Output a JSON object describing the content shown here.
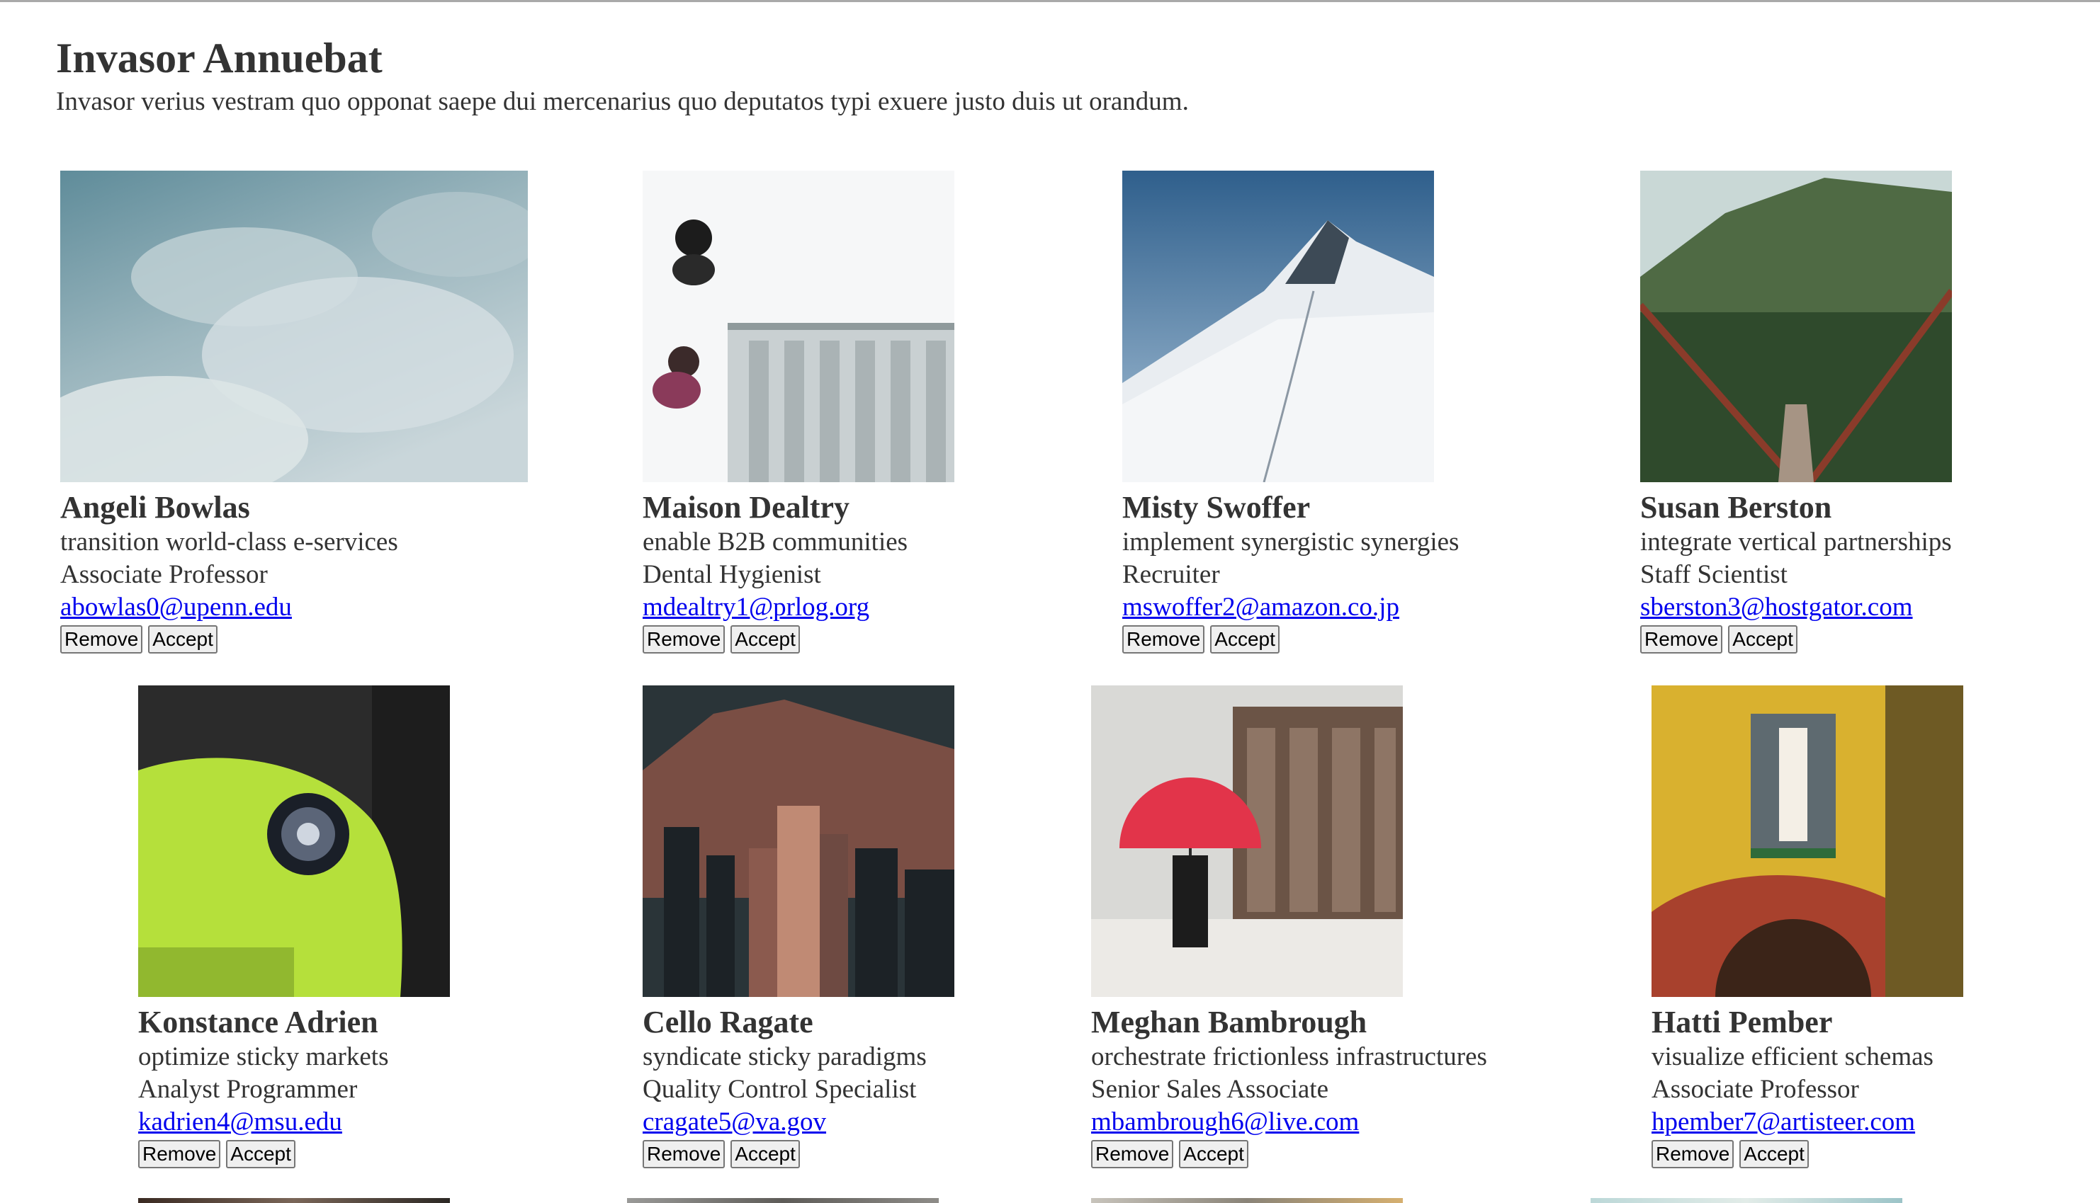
{
  "page": {
    "title": "Invasor Annuebat",
    "subtitle": "Invasor verius vestram quo opponat saepe dui mercenarius quo deputatos typi exuere justo duis ut orandum."
  },
  "buttons": {
    "remove_label": "Remove",
    "accept_label": "Accept"
  },
  "cards": [
    {
      "name": "Angeli Bowlas",
      "tagline": "transition world-class e-services",
      "job": "Associate Professor",
      "email": "abowlas0@upenn.edu",
      "photo": "cloudy-sky-photo"
    },
    {
      "name": "Maison Dealtry",
      "tagline": "enable B2B communities",
      "job": "Dental Hygienist",
      "email": "mdealtry1@prlog.org",
      "photo": "stairs-aerial-photo"
    },
    {
      "name": "Misty Swoffer",
      "tagline": "implement synergistic synergies",
      "job": "Recruiter",
      "email": "mswoffer2@amazon.co.jp",
      "photo": "snowy-mountain-photo"
    },
    {
      "name": "Susan Berston",
      "tagline": "integrate vertical partnerships",
      "job": "Staff Scientist",
      "email": "sberston3@hostgator.com",
      "photo": "forest-bridge-photo"
    },
    {
      "name": "Konstance Adrien",
      "tagline": "optimize sticky markets",
      "job": "Analyst Programmer",
      "email": "kadrien4@msu.edu",
      "photo": "green-car-photo"
    },
    {
      "name": "Cello Ragate",
      "tagline": "syndicate sticky paradigms",
      "job": "Quality Control Specialist",
      "email": "cragate5@va.gov",
      "photo": "city-skyline-photo"
    },
    {
      "name": "Meghan Bambrough",
      "tagline": "orchestrate frictionless infrastructures",
      "job": "Senior Sales Associate",
      "email": "mbambrough6@live.com",
      "photo": "red-umbrella-snow-photo"
    },
    {
      "name": "Hatti Pember",
      "tagline": "visualize efficient schemas",
      "job": "Associate Professor",
      "email": "hpember7@artisteer.com",
      "photo": "yellow-building-photo"
    }
  ]
}
